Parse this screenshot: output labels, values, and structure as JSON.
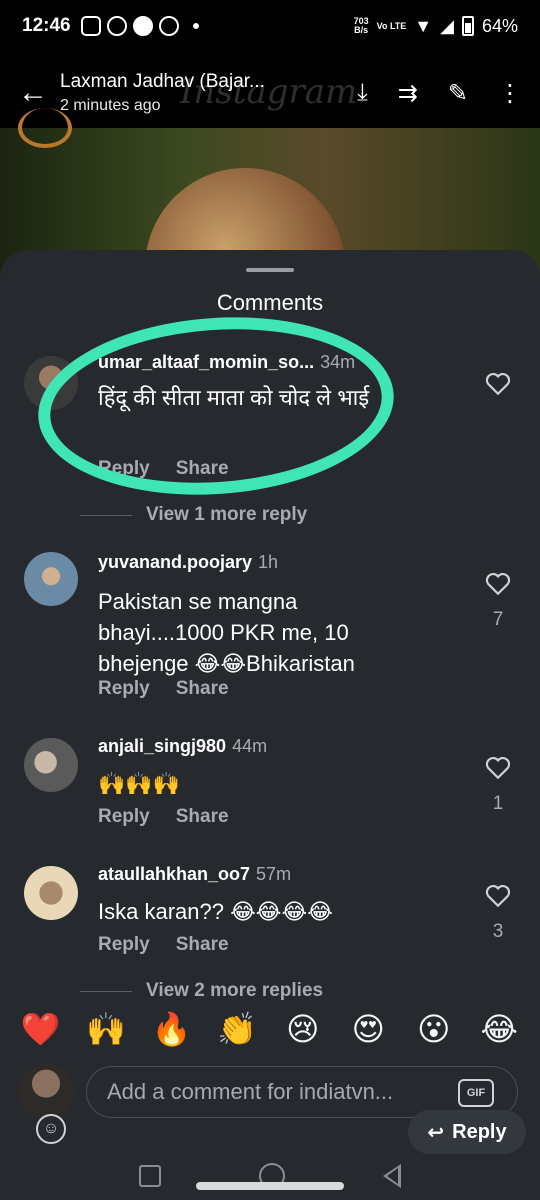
{
  "status_bar": {
    "time": "12:46",
    "net_speed": "703",
    "net_unit": "B/s",
    "lte_label": "Vo LTE",
    "battery": "64%"
  },
  "story": {
    "title": "Laxman Jadhav (Bajar...",
    "subtitle": "2 minutes ago",
    "watermark": "Instagram"
  },
  "sheet": {
    "title": "Comments"
  },
  "comments": [
    {
      "user": "umar_altaaf_momin_so...",
      "time": "34m",
      "text": "हिंदू की सीता माता को चोद ले भाई",
      "reply": "Reply",
      "share": "Share",
      "likes": "",
      "view_replies": "View 1 more reply"
    },
    {
      "user": "yuvanand.poojary",
      "time": "1h",
      "text": "Pakistan se mangna bhayi....1000 PKR me, 10 bhejenge 😂😂Bhikaristan",
      "reply": "Reply",
      "share": "Share",
      "likes": "7"
    },
    {
      "user": "anjali_singj980",
      "time": "44m",
      "text": "🙌🙌🙌",
      "reply": "Reply",
      "share": "Share",
      "likes": "1"
    },
    {
      "user": "ataullahkhan_oo7",
      "time": "57m",
      "text": "Iska karan?? 😂😂😂😂",
      "reply": "Reply",
      "share": "Share",
      "likes": "3",
      "view_replies": "View 2 more replies"
    }
  ],
  "reactions": [
    "❤️",
    "🙌",
    "🔥",
    "👏",
    "😢",
    "😍",
    "😮",
    "😂"
  ],
  "composer": {
    "placeholder": "Add a comment for indiatvn...",
    "gif_label": "GIF",
    "reply_label": "Reply"
  },
  "colors": {
    "sheet_bg": "#262a2f",
    "highlight": "#3fe6b4",
    "muted_text": "#a8acb1"
  }
}
